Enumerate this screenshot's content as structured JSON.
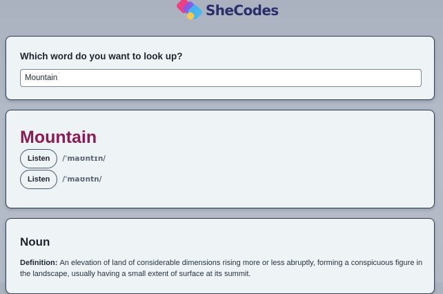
{
  "brand": {
    "logo_text": "SheCodes",
    "colors": {
      "tile_pink": "#f03e82",
      "tile_purple": "#7b5cf0",
      "tile_blue": "#3fb8f2",
      "tile_yellow": "#f7c94a",
      "text": "#2a2f6b"
    }
  },
  "search": {
    "label": "Which word do you want to look up?",
    "value": "Mountain"
  },
  "result": {
    "word": "Mountain",
    "word_color": "#8e1a55",
    "phonetics": [
      {
        "listen_label": "Listen",
        "text": "/ˈmaʊntɪn/"
      },
      {
        "listen_label": "Listen",
        "text": "/ˈmaʊntn/"
      }
    ]
  },
  "meaning": {
    "part_of_speech": "Noun",
    "definition_label": "Definition:",
    "definition_text": "An elevation of land of considerable dimensions rising more or less abruptly, forming a conspicuous figure in the landscape, usually having a small extent of surface at its summit."
  }
}
